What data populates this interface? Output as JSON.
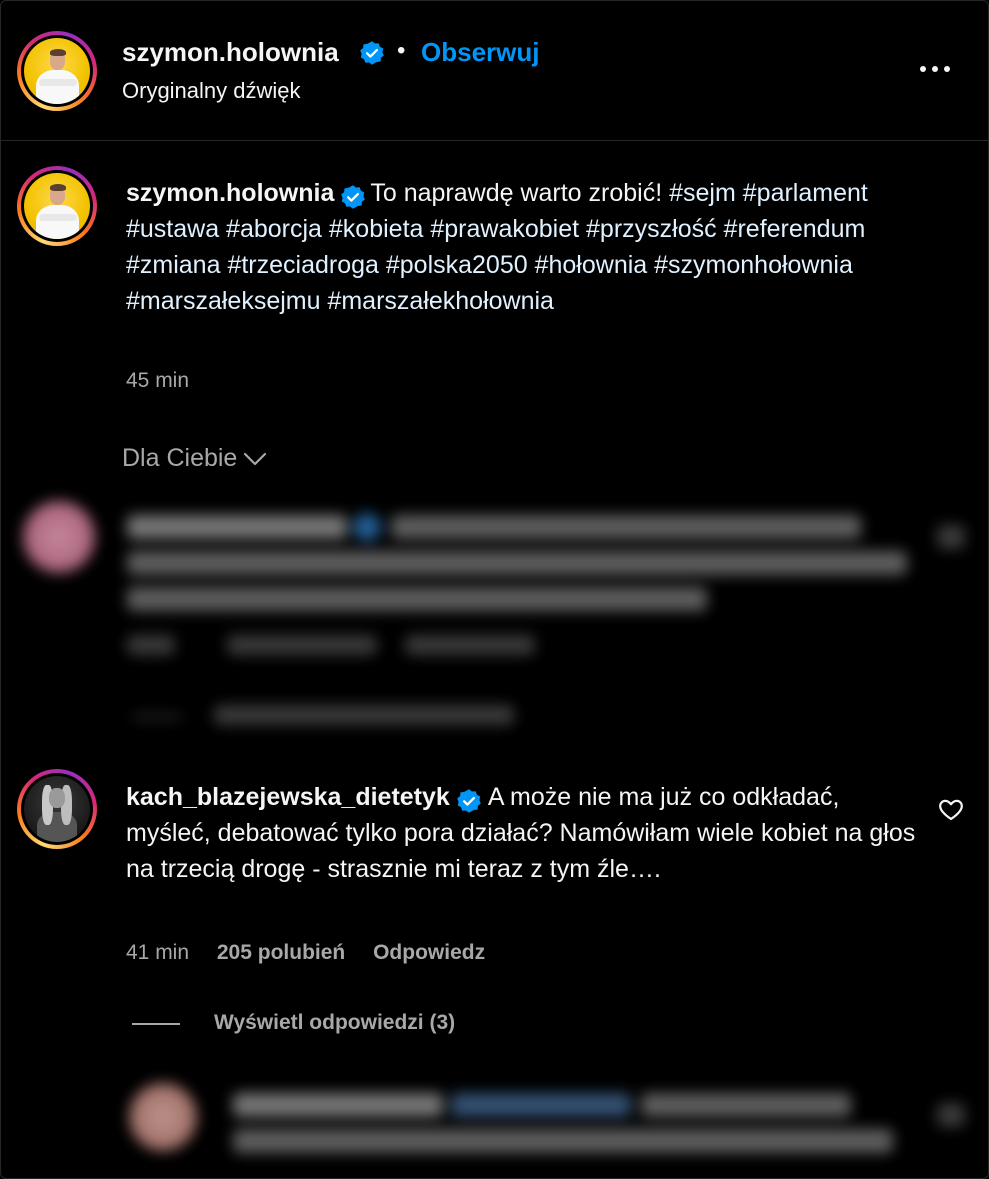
{
  "header": {
    "username": "szymon.holownia",
    "separator": "•",
    "follow_label": "Obserwuj",
    "audio_label": "Oryginalny dźwięk"
  },
  "caption": {
    "username": "szymon.holownia",
    "text": "To naprawdę warto zrobić!",
    "hashtags": "#sejm #parlament #ustawa #aborcja #kobieta #prawakobiet #przyszłość #referendum #zmiana #trzeciadroga #polska2050 #hołownia #szymonhołownia #marszałeksejmu #marszałekhołownia",
    "time": "45 min"
  },
  "sort": {
    "label": "Dla Ciebie"
  },
  "comment": {
    "username": "kach_blazejewska_dietetyk",
    "text": "A może nie ma już co odkładać, myśleć, debatować tylko pora działać? Namówiłam wiele kobiet na głos na trzecią drogę - strasznie mi teraz z tym źle….",
    "time": "41 min",
    "likes": "205 polubień",
    "reply_label": "Odpowiedz",
    "view_replies": "Wyświetl odpowiedzi (3)"
  },
  "colors": {
    "background": "#000000",
    "accent": "#0095f6",
    "muted": "#a8a8a8",
    "verified": "#0095f6"
  },
  "icons": [
    "verified-icon",
    "more-icon",
    "chevron-down-icon",
    "heart-icon"
  ]
}
